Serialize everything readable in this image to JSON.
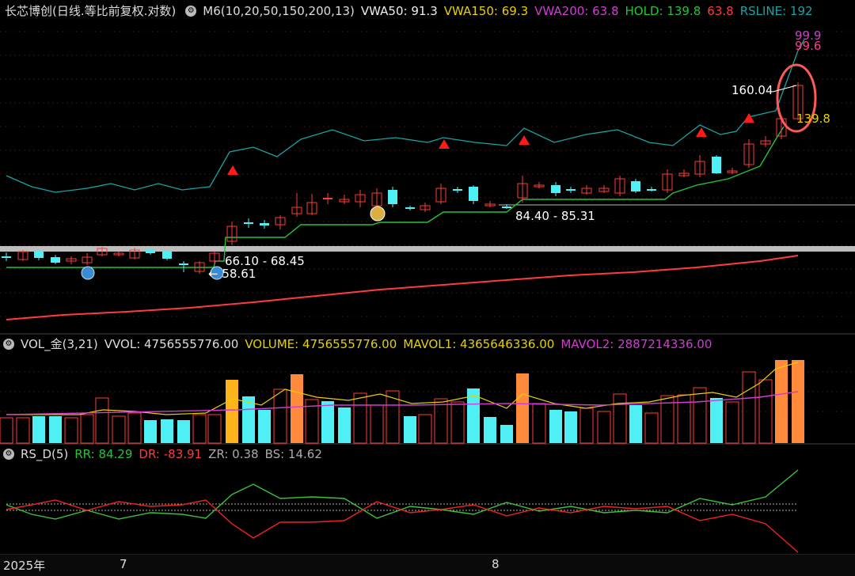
{
  "main_panel": {
    "title": "长芯博创(日线.等比前复权.对数)",
    "indicator": "M6(10,20,50,150,200,13)",
    "vwa50": "VWA50: 91.3",
    "vwa150": "VWA150: 69.3",
    "vwa200": "VWA200: 63.8",
    "hold": "HOLD: 139.8",
    "hold2": "63.8",
    "rsline": "RSLINE: 192",
    "annotations": {
      "top1": "99.9",
      "top2": "99.6",
      "high_price": "160.04",
      "hold_val": "139.8",
      "range1": "84.40 - 85.31",
      "range2": "66.10 - 68.45",
      "low_price": "58.61"
    }
  },
  "vol_panel": {
    "name": "VOL_金(3,21)",
    "vvol": "VVOL: 4756555776.00",
    "volume": "VOLUME: 4756555776.00",
    "mavol1": "MAVOL1: 4365646336.00",
    "mavol2": "MAVOL2: 2887214336.00"
  },
  "rs_panel": {
    "name": "RS_D(5)",
    "rr": "RR: 84.29",
    "dr": "DR: -83.91",
    "zr": "ZR: 0.38",
    "bs": "BS: 14.62"
  },
  "x_axis": {
    "year": "2025年",
    "m7": "7",
    "m8": "8"
  },
  "colors": {
    "up": "#ff3b3b",
    "down": "#4ff0f5",
    "hold": "#22c43a",
    "rsline": "#1aa3a3",
    "vwa50": "#f0f0f0",
    "vwa150": "#e8d000",
    "vwa200": "#d23cd2",
    "orange": "#ff8a3c",
    "gold": "#ffb31a"
  }
}
